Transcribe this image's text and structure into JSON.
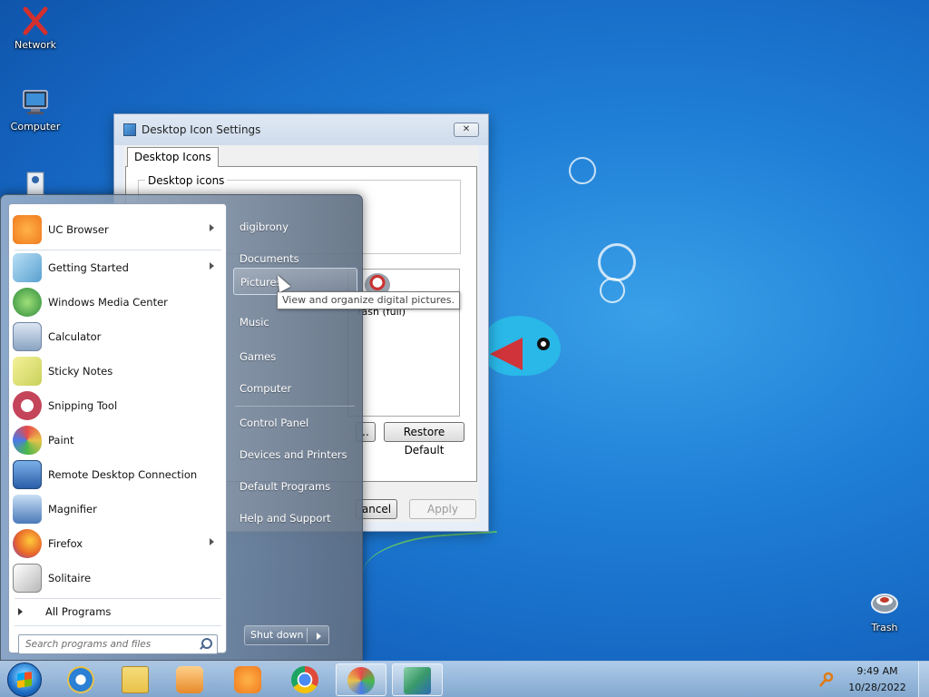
{
  "desktop": {
    "icons": {
      "network": "Network",
      "computer": "Computer",
      "trash": "Trash"
    }
  },
  "dialog": {
    "title": "Desktop Icon Settings",
    "tab": "Desktop Icons",
    "group_label": "Desktop icons",
    "list_item": "rash (full)",
    "restore_default": "Restore Default",
    "partial_button": "..",
    "cancel_partial": "ancel",
    "apply": "Apply"
  },
  "start_menu": {
    "left_items": [
      {
        "label": "UC Browser",
        "icon": "uc-browser-icon",
        "has_submenu": true,
        "color": "#f07a20"
      },
      {
        "label": "Getting Started",
        "icon": "getting-started-icon",
        "has_submenu": true,
        "color": "#5aa0d0"
      },
      {
        "label": "Windows Media Center",
        "icon": "media-center-icon",
        "has_submenu": false,
        "color": "#2d8a3a"
      },
      {
        "label": "Calculator",
        "icon": "calculator-icon",
        "has_submenu": false,
        "color": "#8aa3c2"
      },
      {
        "label": "Sticky Notes",
        "icon": "sticky-notes-icon",
        "has_submenu": false,
        "color": "#d8d45a"
      },
      {
        "label": "Snipping Tool",
        "icon": "snipping-tool-icon",
        "has_submenu": false,
        "color": "#c4445a"
      },
      {
        "label": "Paint",
        "icon": "paint-icon",
        "has_submenu": false,
        "color": "#e0b060"
      },
      {
        "label": "Remote Desktop Connection",
        "icon": "remote-desktop-icon",
        "has_submenu": false,
        "color": "#3a6eb0"
      },
      {
        "label": "Magnifier",
        "icon": "magnifier-icon",
        "has_submenu": false,
        "color": "#4a7ab8"
      },
      {
        "label": "Firefox",
        "icon": "firefox-icon",
        "has_submenu": true,
        "color": "#e8672a"
      },
      {
        "label": "Solitaire",
        "icon": "solitaire-icon",
        "has_submenu": false,
        "color": "#b8b8b8"
      }
    ],
    "all_programs": "All Programs",
    "search_placeholder": "Search programs and files",
    "right_items": [
      {
        "label": "digibrony"
      },
      {
        "label": "Documents"
      },
      {
        "label": "Pictures"
      },
      {
        "label": "Music"
      },
      {
        "label": "Games"
      },
      {
        "label": "Computer"
      },
      {
        "label": "Control Panel"
      },
      {
        "label": "Devices and Printers"
      },
      {
        "label": "Default Programs"
      },
      {
        "label": "Help and Support"
      }
    ],
    "hovered_item": "Pictures",
    "shutdown_label": "Shut down",
    "tooltip": "View and organize digital pictures."
  },
  "taskbar": {
    "pinned": [
      {
        "name": "internet-explorer-icon",
        "color": "#2b7fd4"
      },
      {
        "name": "file-explorer-icon",
        "color": "#e8c24a"
      },
      {
        "name": "media-player-icon",
        "color": "#e88a2a"
      },
      {
        "name": "uc-browser-icon",
        "color": "#f07a20"
      },
      {
        "name": "chrome-icon",
        "color": "#e04a3a"
      },
      {
        "name": "control-panel-icon",
        "color": "#6a8ab0"
      },
      {
        "name": "desktop-icon-settings-icon",
        "color": "#3a9a6a"
      }
    ],
    "time": "9:49 AM",
    "date": "10/28/2022"
  },
  "colors": {
    "desktop_blue": "#1f7fd6",
    "accent": "#1565c0"
  }
}
